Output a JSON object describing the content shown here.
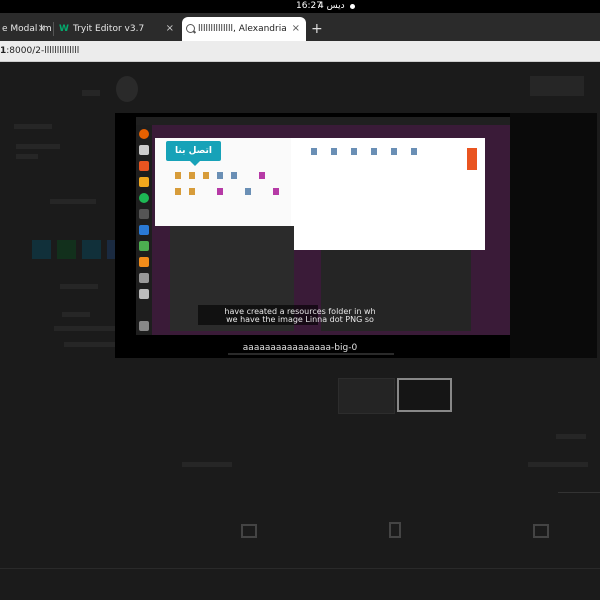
{
  "topbar": {
    "clock": "16:27",
    "date": "4 ديس"
  },
  "tabs": [
    {
      "label": "e Modal Ima"
    },
    {
      "label": "Tryit Editor v3.7"
    },
    {
      "label": "llllllllllllll, Alexandria"
    }
  ],
  "tab_close": "×",
  "new_tab": "+",
  "address": {
    "prefix": "1",
    "rest": ":8000/2-llllllllllllll"
  },
  "overlay": {
    "contact_button": "اتصل بنا",
    "subtitle_line1": "have created a resources folder in wh",
    "subtitle_line2": "we have the image Linna dot PNG so",
    "caption": "aaaaaaaaaaaaaaaa-big-0"
  },
  "colors": {
    "accent": "#17a2b8",
    "dark_bg": "#1b1b1b",
    "tab_active": "#ffffff"
  },
  "icons": [
    "search-icon",
    "tryit-w-icon",
    "close-icon",
    "new-tab-icon",
    "wifi-dot-icon",
    "flag-icon",
    "bookmark-icon",
    "mail-icon"
  ]
}
